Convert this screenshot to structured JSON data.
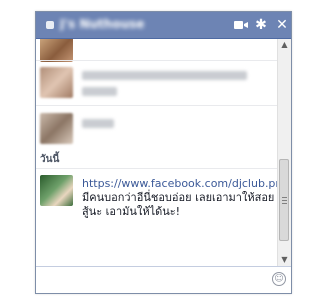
{
  "chat": {
    "title": "J's Nuthouse",
    "day_divider": "วันนี้",
    "last_message": {
      "link": "https://www.facebook.com/djclub.pr",
      "text": " มีคนบอกว่าอีนี่ชอบอ่อย เลยเอามาให้สอย",
      "text2": "สู้นะ เอามันให้ได้นะ!"
    }
  },
  "icons": {
    "video": "video-camera-icon",
    "settings": "gear-icon",
    "close": "close-icon",
    "emoji": "smiley-icon"
  },
  "colors": {
    "titlebar": "#6d84b4",
    "link": "#3b5998"
  }
}
